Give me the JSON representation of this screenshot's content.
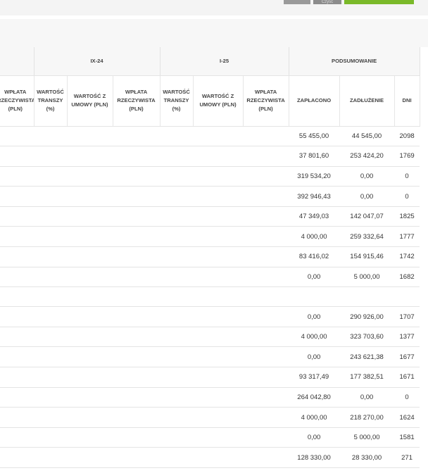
{
  "toolbar": {
    "btn1_label": "",
    "btn2_label": "Czyść",
    "btn3_label": ""
  },
  "table": {
    "groups": [
      "",
      "IX-24",
      "I-25",
      "PODSUMOWANIE"
    ],
    "columns": [
      "WPŁATA RZECZYWISTA (PLN)",
      "WARTOŚĆ TRANSZY (%)",
      "WARTOŚĆ Z UMOWY (PLN)",
      "WPŁATA RZECZYWISTA (PLN)",
      "WARTOŚĆ TRANSZY (%)",
      "WARTOŚĆ Z UMOWY (PLN)",
      "WPŁATA RZECZYWISTA (PLN)",
      "ZAPŁACONO",
      "ZADŁUŻENIE",
      "DNI"
    ],
    "rows": [
      {
        "zaplacono": "55 455,00",
        "zadluzenie": "44 545,00",
        "dni": "2098"
      },
      {
        "zaplacono": "37 801,60",
        "zadluzenie": "253 424,20",
        "dni": "1769"
      },
      {
        "zaplacono": "319 534,20",
        "zadluzenie": "0,00",
        "dni": "0"
      },
      {
        "zaplacono": "392 946,43",
        "zadluzenie": "0,00",
        "dni": "0"
      },
      {
        "zaplacono": "47 349,03",
        "zadluzenie": "142 047,07",
        "dni": "1825"
      },
      {
        "zaplacono": "4 000,00",
        "zadluzenie": "259 332,64",
        "dni": "1777"
      },
      {
        "zaplacono": "83 416,02",
        "zadluzenie": "154 915,46",
        "dni": "1742"
      },
      {
        "zaplacono": "0,00",
        "zadluzenie": "5 000,00",
        "dni": "1682"
      },
      {
        "zaplacono": "",
        "zadluzenie": "",
        "dni": ""
      },
      {
        "zaplacono": "0,00",
        "zadluzenie": "290 926,00",
        "dni": "1707"
      },
      {
        "zaplacono": "4 000,00",
        "zadluzenie": "323 703,60",
        "dni": "1377"
      },
      {
        "zaplacono": "0,00",
        "zadluzenie": "243 621,38",
        "dni": "1677"
      },
      {
        "zaplacono": "93 317,49",
        "zadluzenie": "177 382,51",
        "dni": "1671"
      },
      {
        "zaplacono": "264 042,80",
        "zadluzenie": "0,00",
        "dni": "0"
      },
      {
        "zaplacono": "4 000,00",
        "zadluzenie": "218 270,00",
        "dni": "1624"
      },
      {
        "zaplacono": "0,00",
        "zadluzenie": "5 000,00",
        "dni": "1581"
      },
      {
        "zaplacono": "128 330,00",
        "zadluzenie": "28 330,00",
        "dni": "271"
      }
    ]
  }
}
